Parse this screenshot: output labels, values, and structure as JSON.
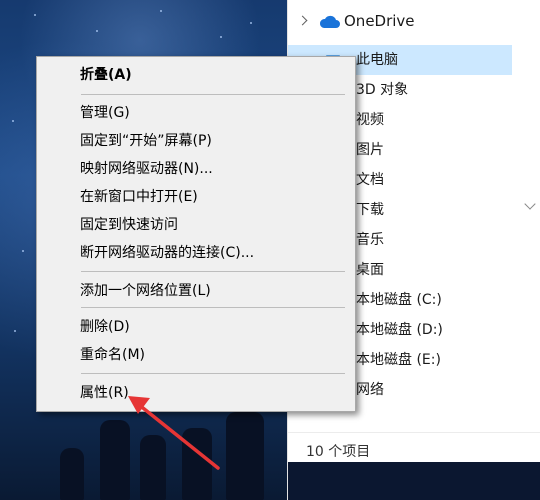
{
  "context_menu": {
    "items": [
      {
        "label": "折叠(A)",
        "bold": true
      },
      {
        "label": "管理(G)"
      },
      {
        "label": "固定到“开始”屏幕(P)"
      },
      {
        "label": "映射网络驱动器(N)..."
      },
      {
        "label": "在新窗口中打开(E)"
      },
      {
        "label": "固定到快速访问"
      },
      {
        "label": "断开网络驱动器的连接(C)..."
      },
      {
        "label": "添加一个网络位置(L)"
      },
      {
        "label": "删除(D)"
      },
      {
        "label": "重命名(M)"
      },
      {
        "label": "属性(R)"
      }
    ]
  },
  "explorer": {
    "onedrive_label": "OneDrive",
    "nav_items": [
      {
        "label": "此电脑",
        "selected": true
      },
      {
        "label": "3D 对象"
      },
      {
        "label": "视频"
      },
      {
        "label": "图片"
      },
      {
        "label": "文档"
      },
      {
        "label": "下载"
      },
      {
        "label": "音乐"
      },
      {
        "label": "桌面"
      },
      {
        "label": "本地磁盘 (C:)"
      },
      {
        "label": "本地磁盘 (D:)"
      },
      {
        "label": "本地磁盘 (E:)"
      },
      {
        "label": "网络"
      }
    ],
    "status": "10 个项目"
  },
  "annotation": {
    "color": "#e63535",
    "points_to": "属性(R)"
  },
  "colors": {
    "selected_bg": "#cce8ff",
    "menu_bg": "#f0f0f0",
    "onedrive_blue": "#1a73d9"
  }
}
